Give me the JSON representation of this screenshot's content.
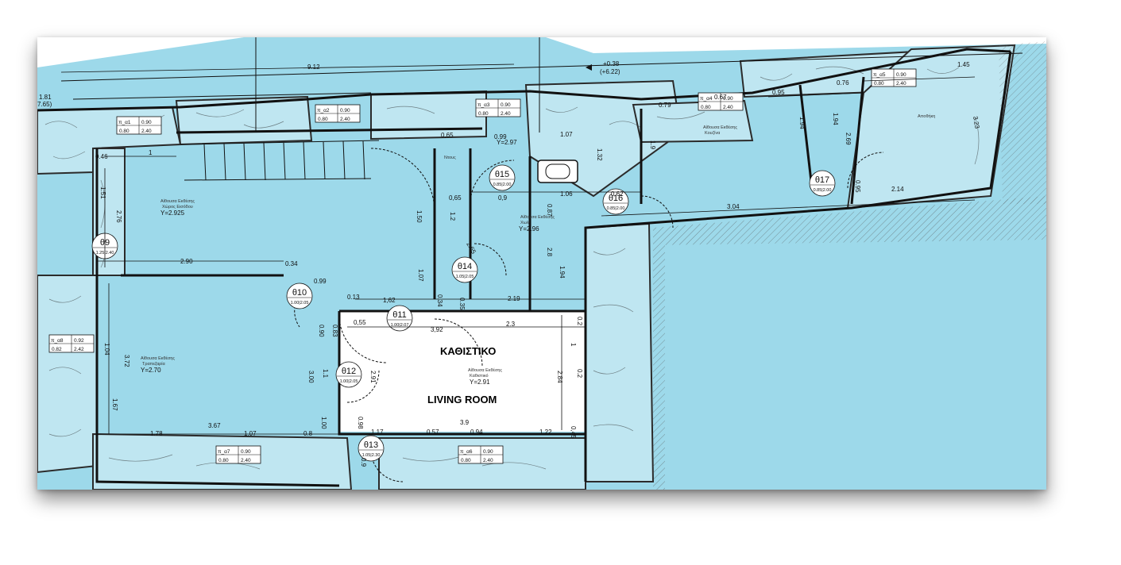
{
  "colors": {
    "fill": "#9dd9ea",
    "walls": "#111111",
    "paper": "#ffffff",
    "living": "#ffffff"
  },
  "rooms": {
    "living_gr": "ΚΑΘΙΣΤΙΚΟ",
    "living_en": "LIVING ROOM",
    "entrance_1": "Αίθουσα Εκθέσης",
    "entrance_2": "Χώρος Εισόδου",
    "entrance_y": "Y=2.925",
    "dining_1": "Αίθουσα Εκθέσης",
    "dining_2": "Τραπεζαρία",
    "dining_y": "Y=2.70",
    "hall_1": "Αίθουσα Εκθέσης",
    "hall_2": "Χωλ",
    "hall_y": "Y=2.96",
    "lr_1": "Αίθουσα Εκθέσης",
    "lr_2": "Καθιστικό",
    "lr_y": "Y=2.91",
    "kitchen_1": "Αίθουσα Εκθέσης",
    "kitchen_2": "Κουζίνα",
    "storage": "Αποθήκη",
    "shower": "Ντους",
    "top_y": "Y=2.97",
    "level_a": "+0.38",
    "level_b": "(+6.22)",
    "left_a": "1.81",
    "left_b": "7.65)"
  },
  "windows": [
    {
      "name": "π_α1",
      "w": "0.90",
      "a": "0.80",
      "b": "2.40"
    },
    {
      "name": "π_α2",
      "w": "0.90",
      "a": "0.80",
      "b": "2.40"
    },
    {
      "name": "π_α3",
      "w": "0.90",
      "a": "0.80",
      "b": "2.40"
    },
    {
      "name": "π_α4",
      "w": "0.90",
      "a": "0.80",
      "b": "2.40"
    },
    {
      "name": "π_α5",
      "w": "0.90",
      "a": "0.80",
      "b": "2.40"
    },
    {
      "name": "π_α8",
      "w": "0.92",
      "a": "0.82",
      "b": "2.42"
    },
    {
      "name": "π_α7",
      "w": "0.90",
      "a": "0.80",
      "b": "2.40"
    },
    {
      "name": "π_α6",
      "w": "0.90",
      "a": "0.80",
      "b": "2.40"
    }
  ],
  "doors": [
    {
      "name": "θ9",
      "a": "1.25",
      "b": "2.40"
    },
    {
      "name": "θ10",
      "a": "1.00",
      "b": "2.05"
    },
    {
      "name": "θ11",
      "a": "1.00",
      "b": "2.07"
    },
    {
      "name": "θ12",
      "a": "1.00",
      "b": "2.05"
    },
    {
      "name": "θ13",
      "a": "1.05",
      "b": "2.30"
    },
    {
      "name": "θ14",
      "a": "1.05",
      "b": "2.05"
    },
    {
      "name": "θ15",
      "a": "0.85",
      "b": "2.00"
    },
    {
      "name": "θ16",
      "a": "0.85",
      "b": "2.00"
    },
    {
      "name": "θ17",
      "a": "0.85",
      "b": "2.00"
    }
  ],
  "dims": {
    "d912": "9.12",
    "d1a": "1",
    "d046": "0.46",
    "d151": "1.51",
    "d276": "2.76",
    "d290": "2.90",
    "d099": "0.99",
    "d034": "0.34",
    "d013": "0.13",
    "d162": "1,62",
    "d104": "1.04",
    "d372": "3.72",
    "d167": "1.67",
    "d178": "1.78",
    "d367": "3.67",
    "d107": "1.07",
    "d08": "0.8",
    "d117": "1.17",
    "d057": "0.57",
    "d094": "0.94",
    "d122": "1.22",
    "d39": "3.9",
    "d045": "0,45",
    "d392": "3,92",
    "d23": "2.3",
    "d055": "0,55",
    "d083": "0.83",
    "d090": "0.90",
    "d300": "3.00",
    "d11": "1.1",
    "d100": "1.00",
    "d098": "0.98",
    "d09": "0.9",
    "d291": "2.91",
    "d284": "2.84",
    "d02": "0.2",
    "d1b": "1",
    "d02b": "0.2",
    "d219": "2.19",
    "d035": "0.35",
    "d034b": "0.34",
    "d107b": "1.07",
    "d265": "2.65",
    "d12": "1.2",
    "d150": "1.50",
    "d065": "0,65",
    "d09b": "0,9",
    "d065b": "0,65",
    "d099b": "0.99",
    "d087": "0.87",
    "d106": "1.06",
    "d062": "0.62",
    "d107c": "1.07",
    "d132": "1.32",
    "d28": "2.8",
    "d194": "1.94",
    "d079": "0.79",
    "d067": "0.67",
    "d095": "0.95",
    "d076": "0.76",
    "d145": "1.45",
    "d19": "1.9",
    "d194b": "1.94",
    "d194c": "1.94",
    "d269": "2.69",
    "d095b": "0.95",
    "d323": "3.23",
    "d214": "2.14",
    "d304": "3.04"
  }
}
